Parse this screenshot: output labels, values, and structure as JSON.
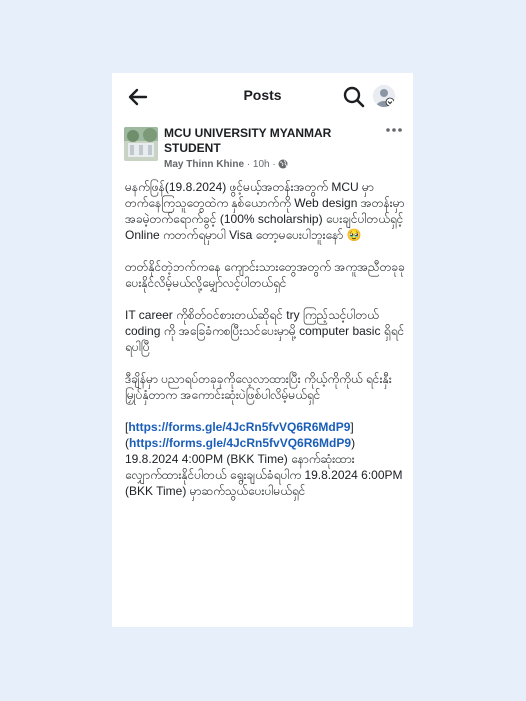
{
  "topbar": {
    "title": "Posts"
  },
  "post": {
    "page_name": "MCU UNIVERSITY MYANMAR STUDENT",
    "author": "May Thinn Khine",
    "time": "10h",
    "separator": " · ",
    "paragraphs": [
      "မနက်ဖြန်(19.8.2024) ဖွင့်မယ့်အတန်းအတွက် MCU မှာတက်နေကြသူတွေထဲက နှစ်ယောက်ကို Web design အတန်းမှာ အခမဲ့တက်ရောက်ခွင့် (100% scholarship) ပေးချင်ပါတယ်ရှင့် Online ကတက်ရမှာပါ Visa တော့မပေးပါဘူးနော် 🥹",
      "တတ်နိုင်တဲ့ဘက်ကနေ ကျောင်းသားတွေအတွက် အကူအညီတခုခု ပေးနိုင်လိမ့်မယ်လို့မျှော်လင့်ပါတယ်ရှင်",
      "IT career ကိုစိတ်ဝင်စားတယ်ဆိုရင် try ကြည့်သင့်ပါတယ် coding ကို အခြေခံကစပြီးသင်ပေးမှာမို့ computer basic ရှိရင်ရပါပြီ",
      "ဒီချိန်မှာ ပညာရပ်တခုခုကိုလေ့လာထားပြီး ကိုယ့်ကိုကိုယ် ရင်းနှီးမြှုပ်နှံတာက အကောင်းဆုံးပဲဖြစ်ပါလိမ့်မယ်ရှင်"
    ],
    "last_para": {
      "bracket_open": "[",
      "link1": "https://forms.gle/4JcRn5fvVQ6R6MdP9",
      "mid": "](",
      "link2": "https://forms.gle/4JcRn5fvVQ6R6MdP9",
      "rest": ") 19.8.2024 4:00PM (BKK Time) နောက်ဆုံးထားလျှောက်ထားနိုင်ပါတယ် ရွေးချယ်ခံရပါက 19.8.2024 6:00PM (BKK Time) မှာဆက်သွယ်ပေးပါမယ်ရှင်"
    }
  },
  "icons": {
    "back": "arrow-left-icon",
    "search": "search-icon",
    "profile": "avatar",
    "globe": "globe-icon",
    "more": "more-horizontal-icon"
  }
}
